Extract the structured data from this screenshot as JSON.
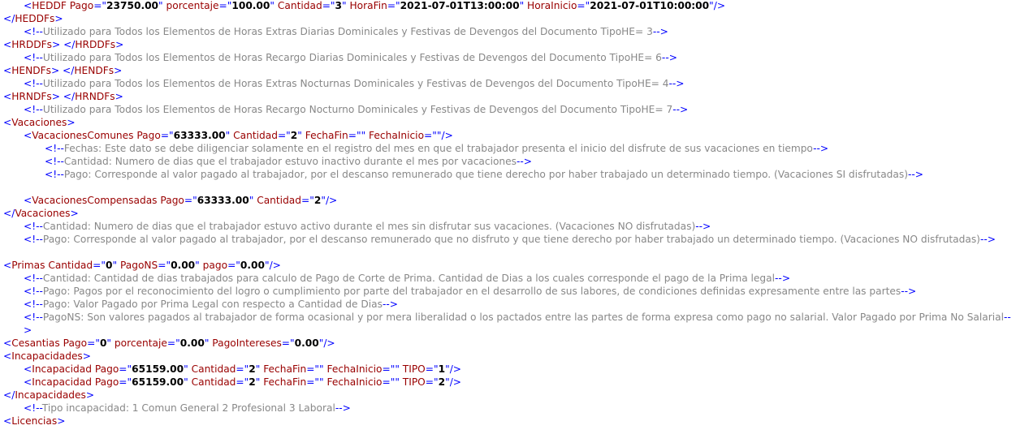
{
  "xml_view": {
    "lines": [
      {
        "depth": 1,
        "kind": "tag",
        "tag": "HEDDF",
        "attrs": [
          {
            "name": "Pago",
            "value": "23750.00"
          },
          {
            "name": "porcentaje",
            "value": "100.00"
          },
          {
            "name": "Cantidad",
            "value": "3"
          },
          {
            "name": "HoraFin",
            "value": "2021-07-01T13:00:00"
          },
          {
            "name": "HoraInicio",
            "value": "2021-07-01T10:00:00"
          }
        ],
        "selfclose": true
      },
      {
        "depth": 0,
        "kind": "close",
        "tag": "HEDDFs"
      },
      {
        "depth": 1,
        "kind": "comment",
        "text": "Utilizado para Todos los Elementos de Horas Extras Diarias Dominicales y Festivas de Devengos del Documento TipoHE= 3"
      },
      {
        "depth": 0,
        "kind": "openclose",
        "tag": "HRDDFs"
      },
      {
        "depth": 1,
        "kind": "comment",
        "text": "Utilizado para Todos los Elementos de Horas Recargo Diarias Dominicales y Festivas de Devengos del Documento TipoHE= 6"
      },
      {
        "depth": 0,
        "kind": "openclose",
        "tag": "HENDFs"
      },
      {
        "depth": 1,
        "kind": "comment",
        "text": "Utilizado para Todos los Elementos de Horas Extras Nocturnas Dominicales y Festivas de Devengos del Documento TipoHE= 4"
      },
      {
        "depth": 0,
        "kind": "openclose",
        "tag": "HRNDFs"
      },
      {
        "depth": 1,
        "kind": "comment",
        "text": "Utilizado para Todos los Elementos de Horas Recargo Nocturno Dominicales y Festivas de Devengos del Documento TipoHE= 7"
      },
      {
        "depth": 0,
        "kind": "tag",
        "tag": "Vacaciones",
        "attrs": [],
        "selfclose": false
      },
      {
        "depth": 1,
        "kind": "tag",
        "tag": "VacacionesComunes",
        "attrs": [
          {
            "name": "Pago",
            "value": "63333.00"
          },
          {
            "name": "Cantidad",
            "value": "2"
          },
          {
            "name": "FechaFin",
            "value": ""
          },
          {
            "name": "FechaInicio",
            "value": ""
          }
        ],
        "selfclose": true
      },
      {
        "depth": 2,
        "kind": "comment",
        "text": "Fechas: Este dato se debe diligenciar solamente en el registro del mes en que el trabajador presenta el inicio del disfrute de sus vacaciones en tiempo"
      },
      {
        "depth": 2,
        "kind": "comment",
        "text": "Cantidad: Numero de dias que el trabajador estuvo inactivo durante el mes por vacaciones"
      },
      {
        "depth": 2,
        "kind": "comment",
        "text": "Pago: Corresponde al valor pagado al trabajador, por el descanso remunerado que tiene derecho por haber trabajado un determinado tiempo. (Vacaciones SI disfrutadas)"
      },
      {
        "depth": 1,
        "kind": "tag",
        "tag": "VacacionesCompensadas",
        "attrs": [
          {
            "name": "Pago",
            "value": "63333.00"
          },
          {
            "name": "Cantidad",
            "value": "2"
          }
        ],
        "selfclose": true
      },
      {
        "depth": 0,
        "kind": "close",
        "tag": "Vacaciones"
      },
      {
        "depth": 1,
        "kind": "comment",
        "text": "Cantidad: Numero de dias que el trabajador estuvo activo durante el mes sin disfrutar sus vacaciones. (Vacaciones NO disfrutadas)"
      },
      {
        "depth": 1,
        "kind": "comment",
        "text": "Pago: Corresponde al valor pagado al trabajador, por el descanso remunerado que no disfruto y que tiene derecho por haber trabajado un determinado tiempo. (Vacaciones NO disfrutadas)"
      },
      {
        "depth": 0,
        "kind": "tag",
        "tag": "Primas",
        "attrs": [
          {
            "name": "Cantidad",
            "value": "0"
          },
          {
            "name": "PagoNS",
            "value": "0.00"
          },
          {
            "name": "pago",
            "value": "0.00"
          }
        ],
        "selfclose": true
      },
      {
        "depth": 1,
        "kind": "comment",
        "text": "Cantidad: Cantidad de dias trabajados para calculo de Pago de Corte de Prima. Cantidad de Dias a los cuales corresponde el pago de la Prima legal"
      },
      {
        "depth": 1,
        "kind": "comment",
        "text": "Pago: Pagos por el reconocimiento del logro o cumplimiento por parte del trabajador en el desarrollo de sus labores, de condiciones definidas expresamente entre las partes"
      },
      {
        "depth": 1,
        "kind": "comment",
        "text": "Pago: Valor Pagado por Prima Legal con respecto a Cantidad de Dias"
      },
      {
        "depth": 1,
        "kind": "comment",
        "text": "PagoNS: Son valores pagados al trabajador de forma ocasional y por mera liberalidad o los pactados entre las partes de forma expresa como pago no salarial. Valor Pagado por Prima No Salarial"
      },
      {
        "depth": 0,
        "kind": "tag",
        "tag": "Cesantias",
        "attrs": [
          {
            "name": "Pago",
            "value": "0"
          },
          {
            "name": "porcentaje",
            "value": "0.00"
          },
          {
            "name": "PagoIntereses",
            "value": "0.00"
          }
        ],
        "selfclose": true
      },
      {
        "depth": 0,
        "kind": "tag",
        "tag": "Incapacidades",
        "attrs": [],
        "selfclose": false
      },
      {
        "depth": 1,
        "kind": "tag",
        "tag": "Incapacidad",
        "attrs": [
          {
            "name": "Pago",
            "value": "65159.00"
          },
          {
            "name": "Cantidad",
            "value": "2"
          },
          {
            "name": "FechaFin",
            "value": ""
          },
          {
            "name": "FechaInicio",
            "value": ""
          },
          {
            "name": "TIPO",
            "value": "1"
          }
        ],
        "selfclose": true
      },
      {
        "depth": 1,
        "kind": "tag",
        "tag": "Incapacidad",
        "attrs": [
          {
            "name": "Pago",
            "value": "65159.00"
          },
          {
            "name": "Cantidad",
            "value": "2"
          },
          {
            "name": "FechaFin",
            "value": ""
          },
          {
            "name": "FechaInicio",
            "value": ""
          },
          {
            "name": "TIPO",
            "value": "2"
          }
        ],
        "selfclose": true
      },
      {
        "depth": 0,
        "kind": "close",
        "tag": "Incapacidades"
      },
      {
        "depth": 1,
        "kind": "comment",
        "text": "Tipo incapacidad: 1 Comun General 2 Profesional 3 Laboral"
      },
      {
        "depth": 0,
        "kind": "tag",
        "tag": "Licencias",
        "attrs": [],
        "selfclose": false
      }
    ]
  }
}
